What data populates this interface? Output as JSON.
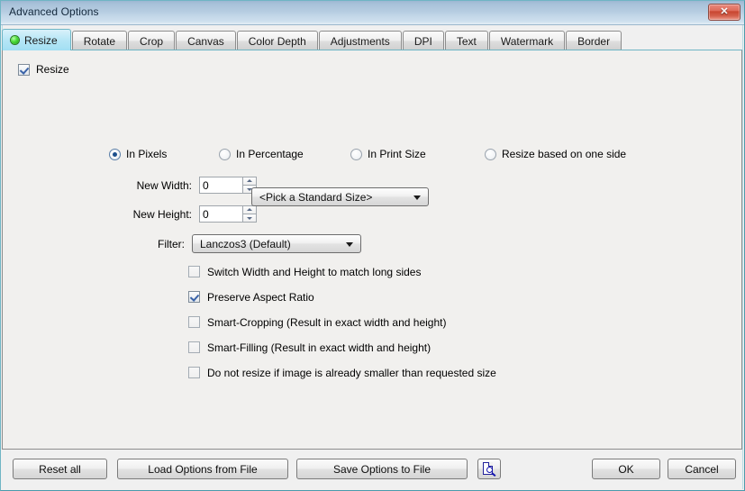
{
  "window": {
    "title": "Advanced Options",
    "close_label": "✕",
    "close_icon": "close-icon"
  },
  "tabs": [
    {
      "label": "Resize",
      "active": true,
      "led": true
    },
    {
      "label": "Rotate",
      "active": false,
      "led": false
    },
    {
      "label": "Crop",
      "active": false,
      "led": false
    },
    {
      "label": "Canvas",
      "active": false,
      "led": false
    },
    {
      "label": "Color Depth",
      "active": false,
      "led": false
    },
    {
      "label": "Adjustments",
      "active": false,
      "led": false
    },
    {
      "label": "DPI",
      "active": false,
      "led": false
    },
    {
      "label": "Text",
      "active": false,
      "led": false
    },
    {
      "label": "Watermark",
      "active": false,
      "led": false
    },
    {
      "label": "Border",
      "active": false,
      "led": false
    }
  ],
  "panel": {
    "enable_resize": {
      "label": "Resize",
      "checked": true
    },
    "mode_radios": [
      {
        "label": "In Pixels",
        "selected": true
      },
      {
        "label": "In Percentage",
        "selected": false
      },
      {
        "label": "In Print Size",
        "selected": false
      },
      {
        "label": "Resize based on one side",
        "selected": false
      }
    ],
    "new_width": {
      "label": "New Width:",
      "value": "0"
    },
    "new_height": {
      "label": "New Height:",
      "value": "0"
    },
    "standard_size": {
      "value": "<Pick a Standard Size>"
    },
    "filter": {
      "label": "Filter:",
      "value": "Lanczos3 (Default)"
    },
    "options": [
      {
        "label": "Switch Width and Height to match long sides",
        "checked": false
      },
      {
        "label": "Preserve Aspect Ratio",
        "checked": true
      },
      {
        "label": "Smart-Cropping (Result in exact width and height)",
        "checked": false
      },
      {
        "label": "Smart-Filling (Result in exact width and height)",
        "checked": false
      },
      {
        "label": "Do not resize if image is already smaller than requested size",
        "checked": false
      }
    ]
  },
  "footer": {
    "reset_all": "Reset all",
    "load_options": "Load Options from File",
    "save_options": "Save Options to File",
    "preview_icon": "preview-document-magnifier-icon",
    "ok": "OK",
    "cancel": "Cancel"
  },
  "colors": {
    "window_border": "#6fb5c4",
    "titlebar_top": "#9db8d2",
    "titlebar_bottom": "#e4eef6",
    "active_tab": "#a2dff3",
    "led_green": "#4ddc3a",
    "close_red": "#c8442f",
    "panel_bg": "#f1f0ee",
    "check_blue": "#3a63a8"
  }
}
